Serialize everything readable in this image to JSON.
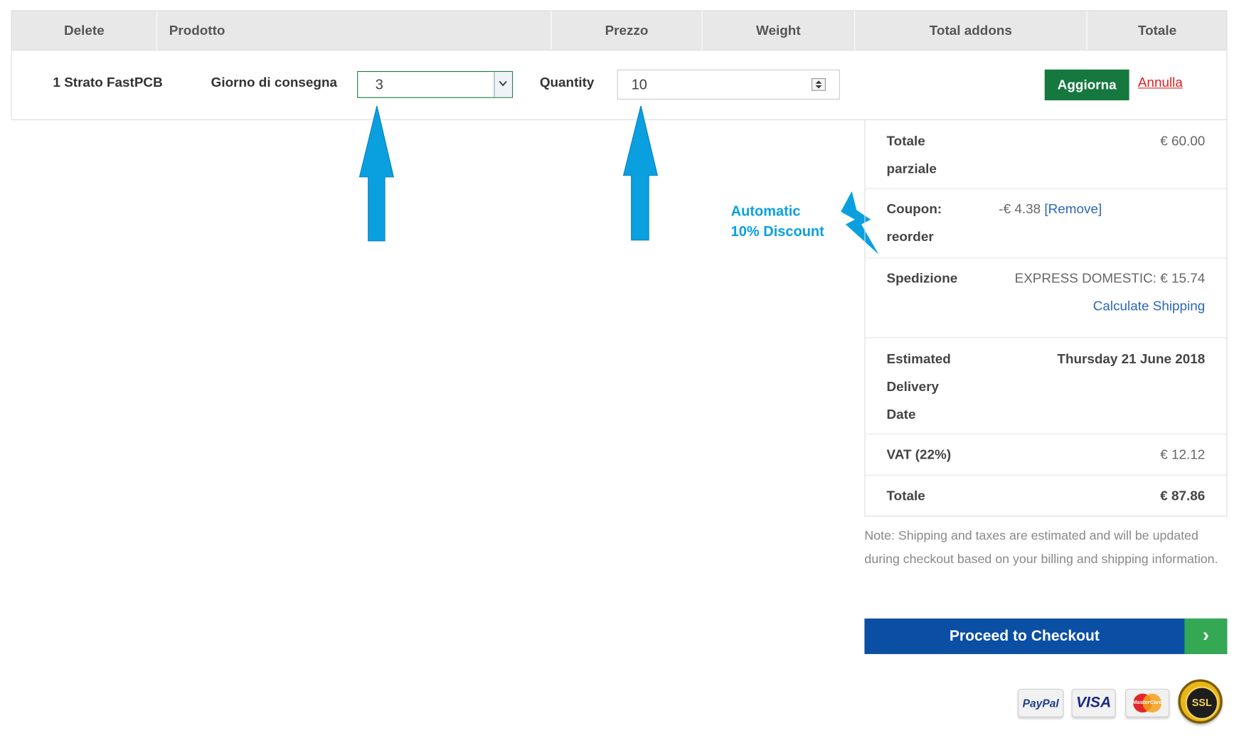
{
  "table": {
    "headers": [
      "Delete",
      "Prodotto",
      "Prezzo",
      "Weight",
      "Total addons",
      "Totale"
    ]
  },
  "product_row": {
    "name": "1 Strato FastPCB",
    "delivery_label": "Giorno di consegna",
    "delivery_value": "3",
    "quantity_label": "Quantity",
    "quantity_value": "10",
    "update_button": "Aggiorna",
    "cancel_link": "Annulla"
  },
  "totals": {
    "subtotal_label_1": "Totale",
    "subtotal_label_2": "parziale",
    "subtotal_value": "€ 60.00",
    "coupon_label_1": "Coupon:",
    "coupon_label_2": "reorder",
    "coupon_value": "-€ 4.38",
    "coupon_remove": "[Remove]",
    "shipping_label": "Spedizione",
    "shipping_value": "EXPRESS DOMESTIC: € 15.74",
    "calculate_shipping": "Calculate Shipping",
    "delivery_label_1": "Estimated",
    "delivery_label_2": "Delivery",
    "delivery_label_3": "Date",
    "delivery_value": "Thursday 21 June 2018",
    "vat_label": "VAT (22%)",
    "vat_value": "€ 12.12",
    "total_label": "Totale",
    "total_value": "€ 87.86"
  },
  "note": "Note: Shipping and taxes are estimated and will be updated during checkout based on your billing and shipping information.",
  "checkout": {
    "label": "Proceed to Checkout",
    "arrow": "›"
  },
  "annotation": {
    "line1": "Automatic",
    "line2": "10% Discount"
  },
  "payment_badges": {
    "paypal": "PayPal",
    "visa": "VISA",
    "mastercard": "MasterCard",
    "ssl": "SSL"
  },
  "colors": {
    "aggiorna_green": "#15783e",
    "checkout_blue": "#0a4fa3",
    "checkout_arrow_green": "#34a853",
    "annulla_red": "#e02020",
    "link_blue": "#2a67b8",
    "annotation_cyan": "#0aa0e0"
  },
  "icons": [
    "chevron-down-icon",
    "spinner-arrows-icon",
    "arrow-up-icon",
    "lightning-bolt-icon",
    "chevron-right-icon"
  ]
}
